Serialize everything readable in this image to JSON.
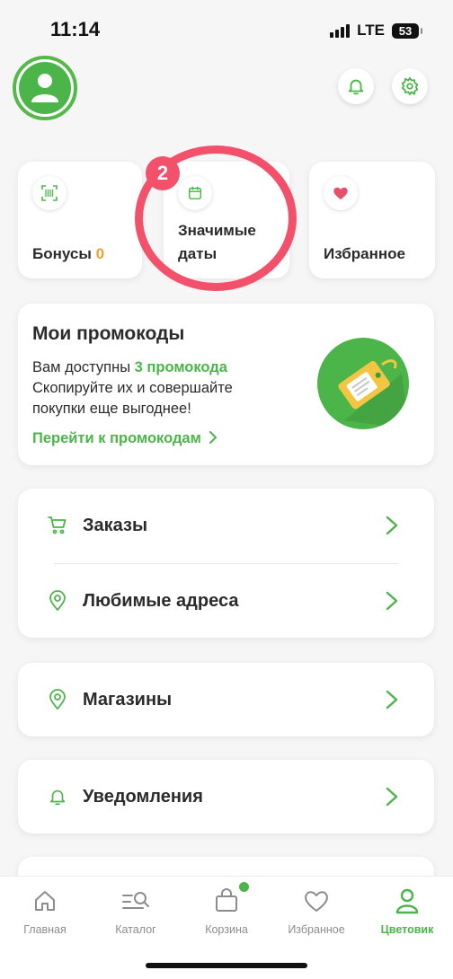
{
  "status_bar": {
    "time": "11:14",
    "network": "LTE",
    "battery": "53"
  },
  "header": {
    "avatar_icon": "user-icon",
    "notifications_icon": "bell-icon",
    "settings_icon": "gear-icon"
  },
  "quick_cards": {
    "bonuses": {
      "label": "Бонусы",
      "count": "0",
      "icon": "barcode-scan-icon"
    },
    "dates": {
      "label_line1": "Значимые",
      "label_line2": "даты",
      "icon": "calendar-icon"
    },
    "favorites": {
      "label": "Избранное",
      "icon": "heart-icon"
    }
  },
  "highlight": {
    "badge": "2",
    "color": "#f2506b"
  },
  "promo": {
    "title": "Мои промокоды",
    "text_prefix": "Вам доступны ",
    "text_highlight": "3 промокода",
    "text_rest": "Скопируйте их и совершайте покупки еще выгоднее!",
    "link": "Перейти к промокодам"
  },
  "menu": {
    "orders": "Заказы",
    "addresses": "Любимые адреса",
    "stores": "Магазины",
    "notifications": "Уведомления"
  },
  "tabbar": {
    "items": [
      {
        "label": "Главная",
        "icon": "home-icon"
      },
      {
        "label": "Каталог",
        "icon": "catalog-search-icon"
      },
      {
        "label": "Корзина",
        "icon": "bag-icon"
      },
      {
        "label": "Избранное",
        "icon": "heart-outline-icon"
      },
      {
        "label": "Цветовик",
        "icon": "profile-icon"
      }
    ],
    "active_index": 4
  },
  "colors": {
    "accent": "#4cb54a",
    "bonus": "#f0a030",
    "highlight": "#f2506b"
  }
}
